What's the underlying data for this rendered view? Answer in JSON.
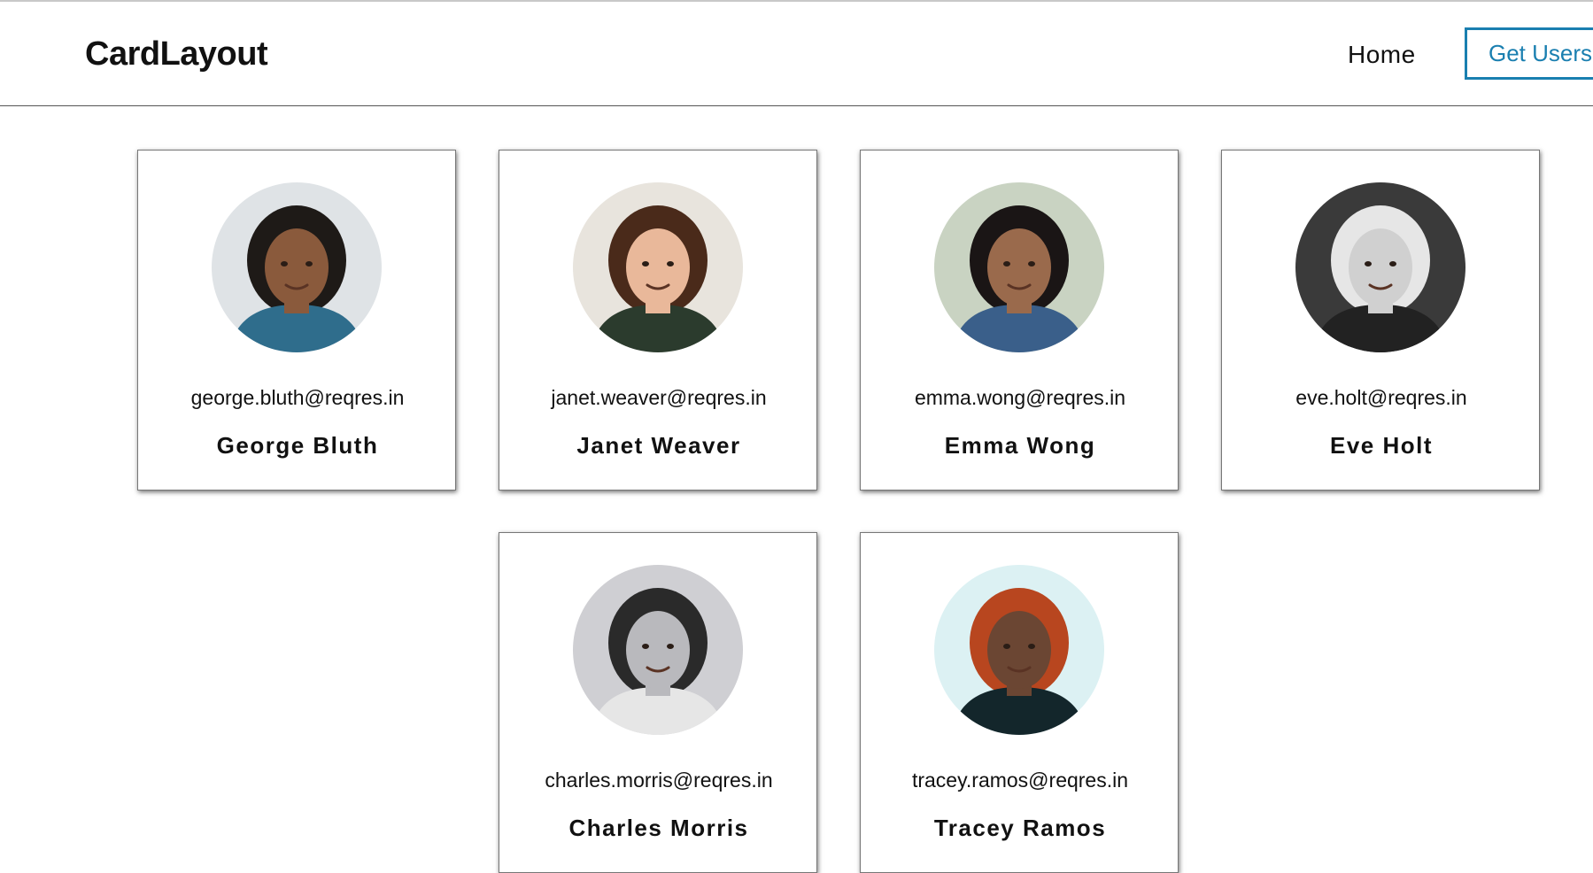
{
  "navbar": {
    "brand": "CardLayout",
    "home_label": "Home",
    "get_users_label": "Get Users"
  },
  "users": [
    {
      "email": "george.bluth@reqres.in",
      "name": "George Bluth",
      "avatar_bg": "#dfe3e6",
      "skin": "#8a5a3c",
      "hair": "#1e1a17",
      "shirt": "#2f6d8c"
    },
    {
      "email": "janet.weaver@reqres.in",
      "name": "Janet Weaver",
      "avatar_bg": "#e8e4dd",
      "skin": "#e9b89a",
      "hair": "#4a2a1a",
      "shirt": "#2b3b2d"
    },
    {
      "email": "emma.wong@reqres.in",
      "name": "Emma Wong",
      "avatar_bg": "#c9d3c2",
      "skin": "#9a6a4c",
      "hair": "#1a1515",
      "shirt": "#3a5f8a"
    },
    {
      "email": "eve.holt@reqres.in",
      "name": "Eve Holt",
      "avatar_bg": "#3a3a3a",
      "skin": "#d0d0d0",
      "hair": "#e6e6e6",
      "shirt": "#222222"
    },
    {
      "email": "charles.morris@reqres.in",
      "name": "Charles Morris",
      "avatar_bg": "#cfcfd3",
      "skin": "#b9b9bd",
      "hair": "#2a2a2a",
      "shirt": "#e6e6e6"
    },
    {
      "email": "tracey.ramos@reqres.in",
      "name": "Tracey Ramos",
      "avatar_bg": "#dcf1f3",
      "skin": "#6b4633",
      "hair": "#b8461f",
      "shirt": "#13262b"
    }
  ]
}
